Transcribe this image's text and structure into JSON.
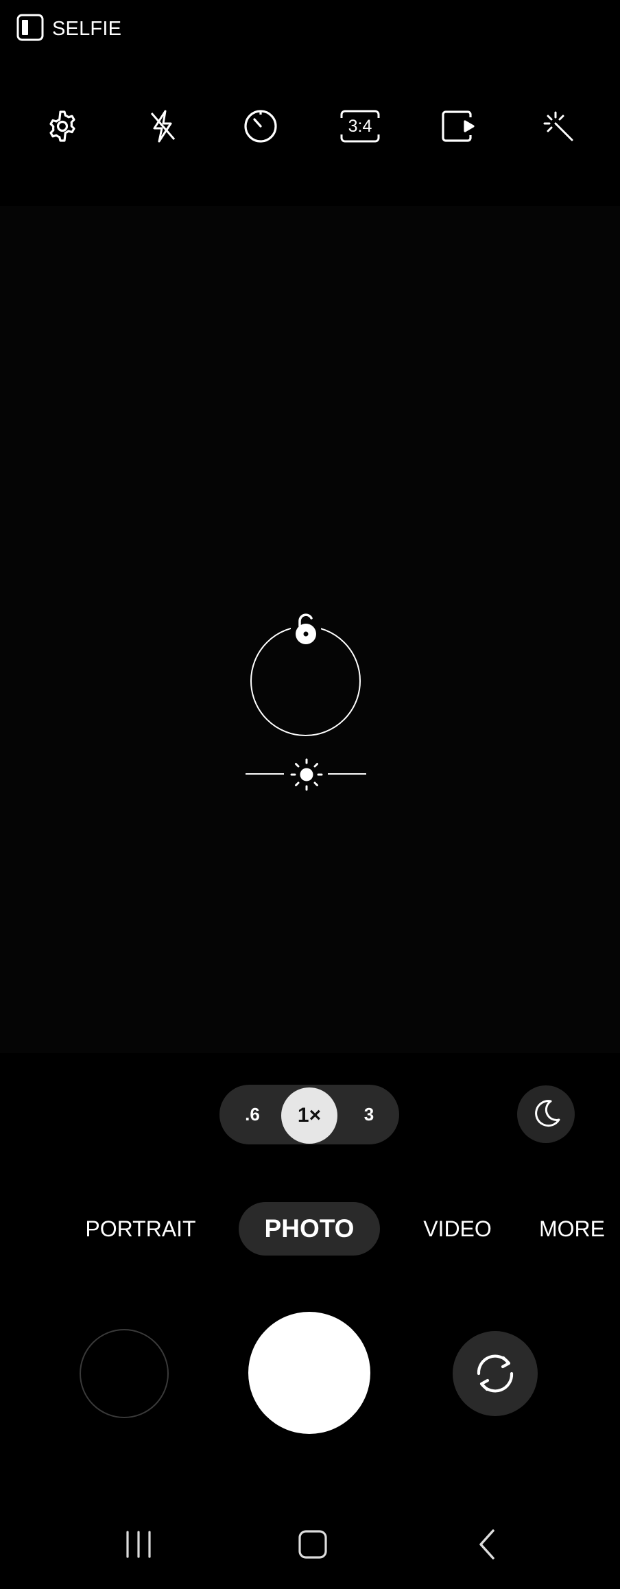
{
  "status": {
    "selfie_label": "SELFIE",
    "icon": "selfie-frame-icon"
  },
  "toolbar": {
    "settings_icon": "gear-icon",
    "flash_icon": "flash-off-icon",
    "timer_icon": "timer-icon",
    "ratio_label": "3:4",
    "motion_icon": "motion-photo-icon",
    "filters_icon": "magic-wand-icon"
  },
  "viewfinder": {
    "lock_icon": "unlock-icon",
    "brightness_icon": "sun-icon"
  },
  "zoom": {
    "options": [
      ".6",
      "1×",
      "3"
    ],
    "selected": "1×"
  },
  "night_icon": "moon-icon",
  "modes": [
    "PORTRAIT",
    "PHOTO",
    "VIDEO",
    "MORE"
  ],
  "active_mode": "PHOTO",
  "controls": {
    "switch_icon": "switch-camera-icon"
  },
  "navbar": {
    "recents_icon": "recents-icon",
    "home_icon": "home-icon",
    "back_icon": "back-icon"
  },
  "colors": {
    "background": "#000000",
    "accent_pill": "#2a2a2a",
    "shutter": "#ffffff"
  }
}
